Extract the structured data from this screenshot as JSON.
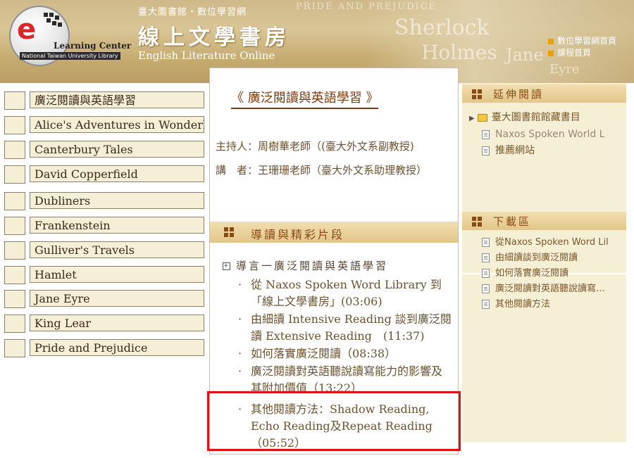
{
  "header": {
    "top_line": "臺大圖書館・數位學習網",
    "title": "線上文學書房",
    "subtitle": "English Literature Online",
    "logo_label": "Learning Center",
    "library_label": "National Taiwan University Library",
    "bg_words": [
      "PRIDE AND PREJUDICE",
      "Sherlock",
      "Holmes",
      "Jane",
      "Eyre"
    ],
    "links": [
      "數位學習網首頁",
      "課程首頁"
    ]
  },
  "left_nav": [
    "廣泛閱讀與英語學習",
    "Alice's Adventures in Wonderland",
    "Canterbury Tales",
    "David Copperfield",
    "Dubliners",
    "Frankenstein",
    "Gulliver's Travels",
    "Hamlet",
    "Jane Eyre",
    "King Lear",
    "Pride and Prejudice"
  ],
  "course": {
    "title": "《 廣泛閱讀與英語學習 》",
    "host": "主持人：周樹華老師（(臺大外文系副教授)",
    "speaker": "講　者：王珊珊老師（臺大外文系助理教授）",
    "section_title": "導讀與精彩片段",
    "tree_root": "導言一廣泛閱讀與英語學習",
    "chapters": [
      "從 Naxos Spoken Word Library 到「線上文學書房」(03:06)",
      "由細讀 Intensive Reading 談到廣泛閱讀 Extensive Reading　(11:37)",
      "如何落實廣泛閱讀（08:38）",
      "廣泛閱讀對英語聽說讀寫能力的影響及其附加價值（13:22）",
      "其他閱讀方法：Shadow Reading, Echo Reading及Repeat Reading（05:52）"
    ]
  },
  "right": {
    "extended_title": "延伸閱讀",
    "extended_items": [
      "臺大圖書館館藏書目",
      "Naxos Spoken World L",
      "推薦網站"
    ],
    "download_title": "下載區",
    "download_items": [
      "從Naxos Spoken Word Lil",
      "由細讀談到廣泛閱讀",
      "如何落實廣泛閱讀",
      "廣泛閱讀對英語聽說讀寫…",
      "其他閱讀方法"
    ]
  },
  "colors": {
    "accent": "#8a4a14",
    "highlight": "#e0101a",
    "panel": "#f5efd6"
  }
}
